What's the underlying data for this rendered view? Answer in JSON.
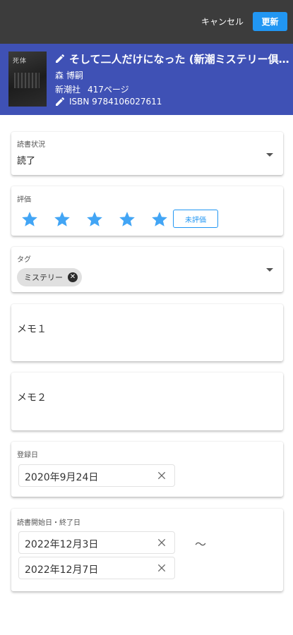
{
  "toolbar": {
    "cancel_label": "キャンセル",
    "update_label": "更新",
    "update_color": "#2196f3"
  },
  "book": {
    "cover_text": "死体",
    "title": "そして二人だけになった (新潮ミステリー倶楽部)",
    "author": "森 博嗣",
    "publisher": "新潮社",
    "pages": "417ページ",
    "isbn": "ISBN 9784106027611",
    "header_color": "#3f51b5"
  },
  "status": {
    "label": "読書状況",
    "value": "読了"
  },
  "rating": {
    "label": "評価",
    "stars": 5,
    "unrated_label": "未評価",
    "star_color": "#42a5f5"
  },
  "tags": {
    "label": "タグ",
    "chips": [
      "ミステリー"
    ]
  },
  "memo1": {
    "label": "メモ１"
  },
  "memo2": {
    "label": "メモ２"
  },
  "registered": {
    "label": "登録日",
    "value": "2020年9月24日"
  },
  "reading_period": {
    "label": "読書開始日・終了日",
    "start": "2022年12月3日",
    "end": "2022年12月7日",
    "separator": "～"
  },
  "icons": {
    "edit": "pencil-icon",
    "dropdown": "caret-down-icon",
    "clear": "close-icon",
    "chip_remove": "cancel-circle-icon"
  }
}
